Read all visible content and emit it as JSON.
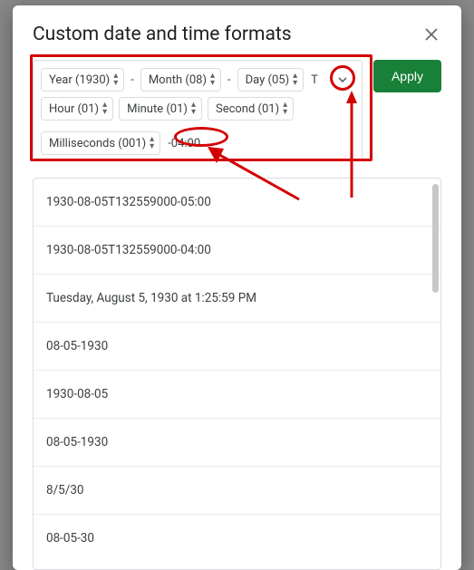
{
  "dialog": {
    "title": "Custom date and time formats",
    "apply_label": "Apply"
  },
  "tokens": {
    "year": "Year (1930)",
    "month": "Month (08)",
    "day": "Day (05)",
    "hour": "Hour (01)",
    "minute": "Minute (01)",
    "second": "Second (01)",
    "millis": "Milliseconds (001)",
    "sep_dash": "-",
    "literal_T": "T",
    "literal_tz": "-04:00"
  },
  "presets": [
    "1930-08-05T132559000-05:00",
    "1930-08-05T132559000-04:00",
    "Tuesday, August 5, 1930 at 1:25:59 PM",
    "08-05-1930",
    "1930-08-05",
    "08-05-1930",
    "8/5/30",
    "08-05-30"
  ]
}
